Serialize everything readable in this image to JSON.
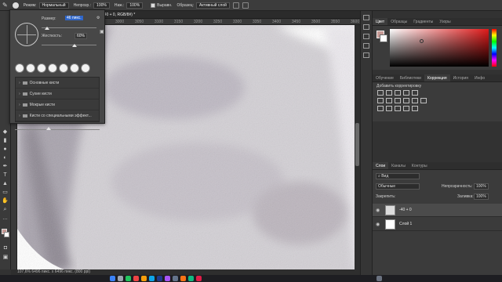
{
  "options_bar": {
    "mode_label": "Режим:",
    "mode_value": "Нормальный",
    "opacity_label": "Непрозр.:",
    "opacity_value": "100%",
    "pressure_label": "Наж.:",
    "pressure_value": "100%",
    "align_label": "Выравн.",
    "sample_label": "Образец:",
    "sample_value": "Активный слой"
  },
  "document": {
    "tab_title": "-40 + 0, RGB/8#) *",
    "ruler_ticks": [
      "2750",
      "2800",
      "2850",
      "2900",
      "2950",
      "3000",
      "3050",
      "3100",
      "3150",
      "3200",
      "3250",
      "3300",
      "3350",
      "3400",
      "3450",
      "3500",
      "3550",
      "3600"
    ],
    "status": "107,6%   6496 пикс. x 6496 пикс. (800 ppi)"
  },
  "brush_popup": {
    "size_label": "Размер:",
    "size_value": "46 пикс.",
    "hardness_label": "Жесткость:",
    "hardness_value": "60%",
    "size_level": 0.1,
    "hardness_level": 0.6,
    "folders": [
      {
        "label": "Основные кисти"
      },
      {
        "label": "Сухие кисти"
      },
      {
        "label": "Мокрые кисти"
      },
      {
        "label": "Кисти со специальными эффект..."
      }
    ]
  },
  "color_panel": {
    "tabs": [
      "Цвет",
      "Образцы",
      "Градиенты",
      "Узоры"
    ],
    "foreground": "#c79a95",
    "background": "#ffffff"
  },
  "adjustments_panel": {
    "tabs": [
      "Обучение",
      "Библиотеки",
      "Коррекция",
      "История",
      "Инфо"
    ],
    "add_label": "Добавить корректировку"
  },
  "layers_panel": {
    "tabs": [
      "Слои",
      "Каналы",
      "Контуры"
    ],
    "kind_value": "Вид",
    "blend_value": "Обычные",
    "opacity_label": "Непрозрачность:",
    "opacity_value": "100%",
    "lock_label": "Закрепить:",
    "fill_label": "Заливка:",
    "fill_value": "100%",
    "layers": [
      {
        "name": "-40 + 0",
        "selected": true
      },
      {
        "name": "Слой 1",
        "selected": false
      }
    ]
  }
}
